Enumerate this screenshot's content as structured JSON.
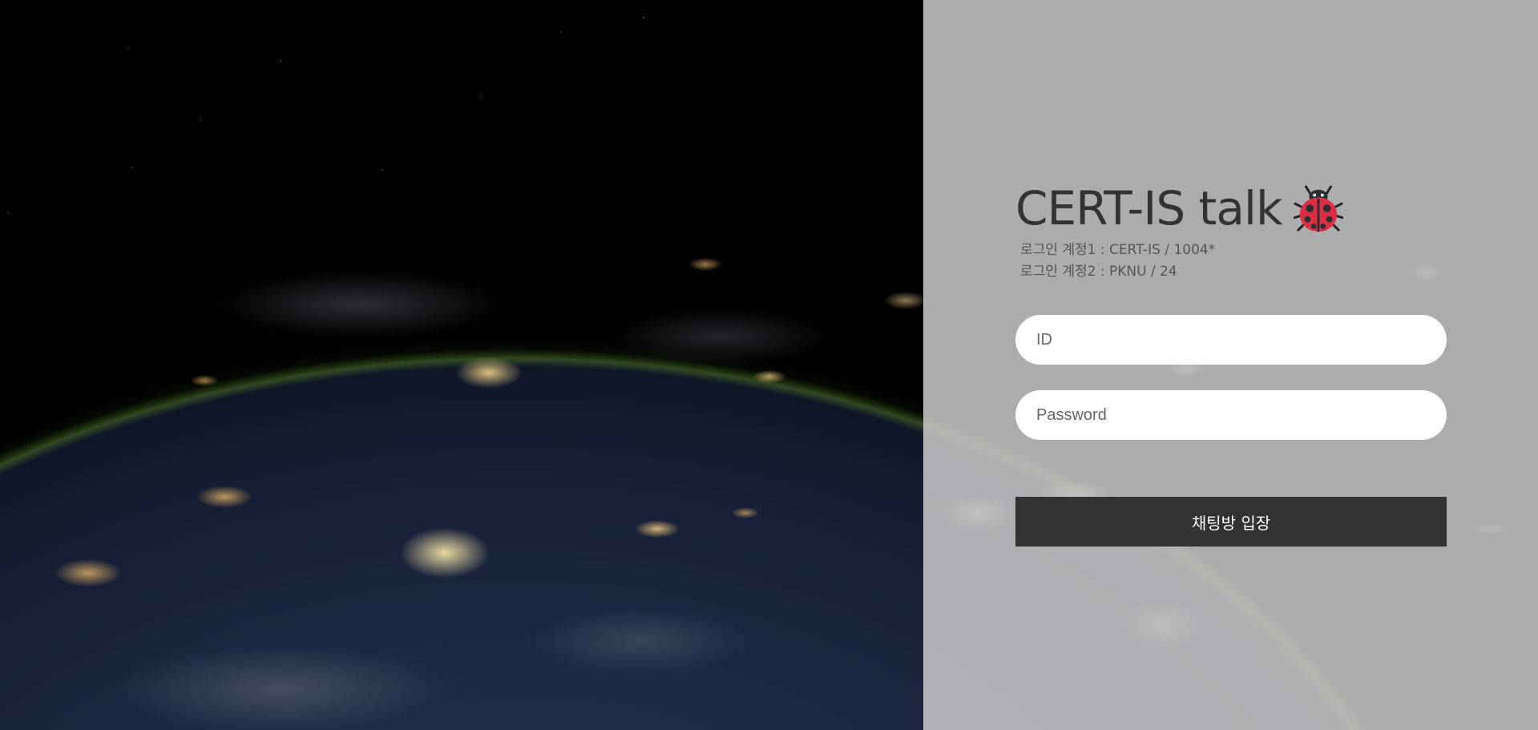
{
  "login": {
    "title": "CERT-IS talk",
    "title_icon": "ladybug-icon",
    "accounts": [
      {
        "label": "로그인 계정1 : CERT-IS / 1004*"
      },
      {
        "label": "로그인 계정2 : PKNU / 24"
      }
    ],
    "id_placeholder": "ID",
    "password_placeholder": "Password",
    "submit_label": "채팅방 입장"
  },
  "colors": {
    "panel_overlay": "#c8c8c8",
    "button_bg": "#333333",
    "title_text": "#333333",
    "ladybug_red": "#dd2e44"
  }
}
